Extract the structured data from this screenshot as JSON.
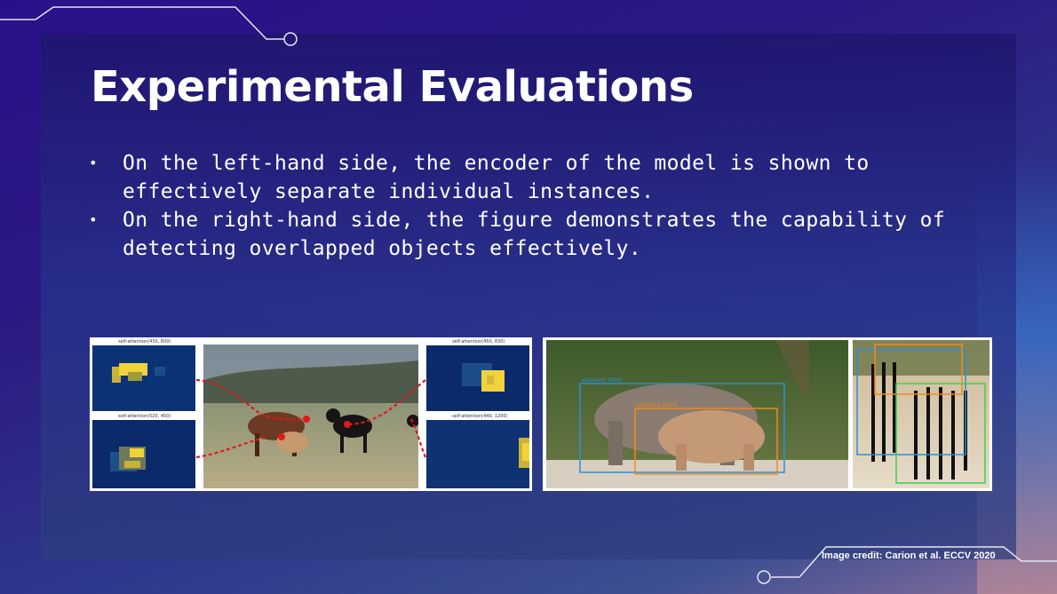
{
  "slide": {
    "title": "Experimental Evaluations",
    "bullets": [
      "On the left-hand side, the encoder of the model is shown to effectively separate individual instances.",
      "On the right-hand side, the figure demonstrates the capability of detecting overlapped objects effectively."
    ],
    "credit": "Image credit: Carion et al. ECCV 2020",
    "bullet_glyph": "•"
  },
  "figure_left": {
    "attention_labels": [
      "self-attention(430, 600)",
      "self-attention(520, 450)",
      "self-attention(450, 830)",
      "self-attention(440, 1200)"
    ]
  },
  "figure_right": {
    "detections": [
      "elephant 100%",
      "elephant 100%"
    ]
  },
  "colors": {
    "accent_line": "#e6e6f0",
    "attention_bg": "#0b2a6b",
    "attention_hot": "#f2d23a",
    "arrow": "#e01a1a",
    "box_blue": "#2a8fd6",
    "box_orange": "#f08a1c",
    "box_green": "#3ccf4e"
  }
}
